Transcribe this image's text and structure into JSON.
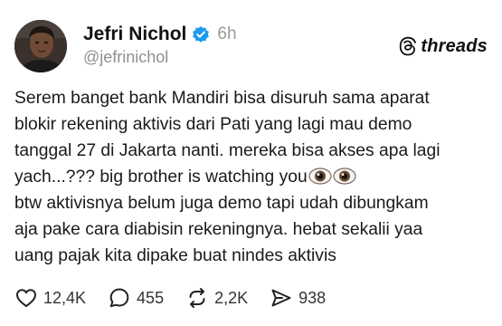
{
  "post": {
    "author_name": "Jefri Nichol",
    "timestamp": "6h",
    "handle": "@jefrinichol",
    "verified_icon": "verified-badge-icon",
    "brand": {
      "icon": "threads-logo-icon",
      "label": "threads"
    },
    "paragraph1_lines": [
      "Serem banget bank Mandiri bisa disuruh sama aparat",
      "blokir rekening aktivis dari Pati yang lagi mau demo",
      "tanggal 27 di Jakarta nanti. mereka bisa akses apa lagi",
      "yach...??? big brother is watching you"
    ],
    "paragraph1_emoji": "eyes-emoji",
    "paragraph2_lines": [
      "btw aktivisnya belum juga demo tapi udah dibungkam",
      "aja pake cara diabisin rekeningnya. hebat sekalii yaa",
      "uang pajak kita dipake buat nindes aktivis"
    ],
    "actions": {
      "likes": "12,4K",
      "replies": "455",
      "reposts": "2,2K",
      "shares": "938"
    }
  },
  "colors": {
    "verified": "#1d9bf0",
    "muted_text": "#8f8f8f",
    "text": "#111111",
    "background": "#ffffff"
  }
}
